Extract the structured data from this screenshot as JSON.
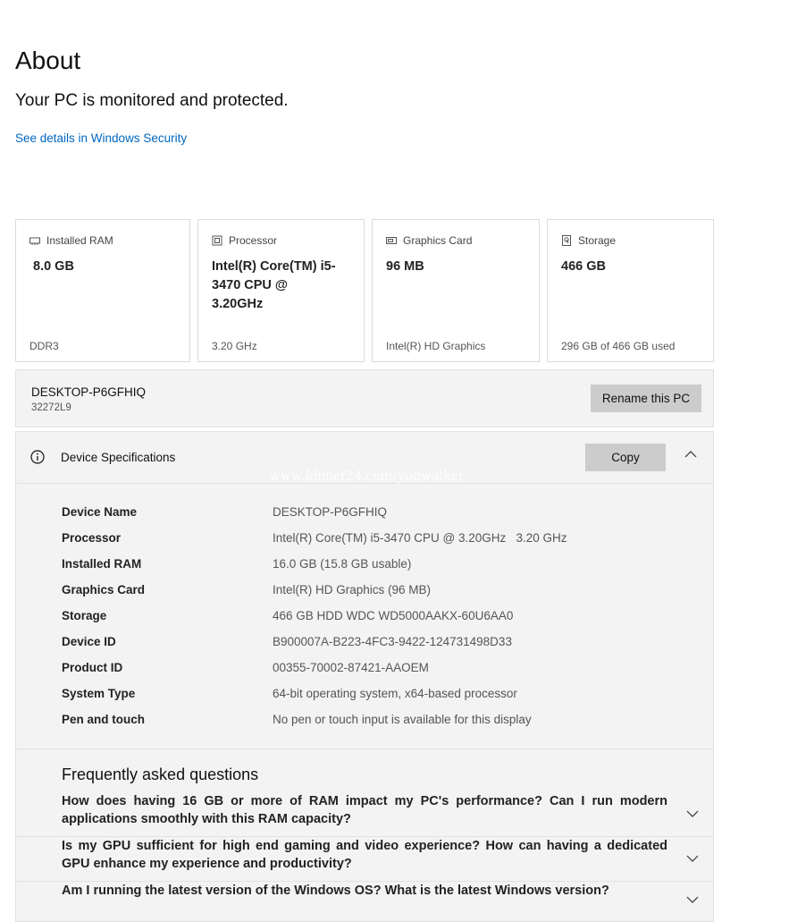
{
  "page": {
    "title": "About",
    "status": "Your PC is monitored and protected.",
    "security_link": "See details in Windows Security"
  },
  "cards": [
    {
      "label": "Installed RAM",
      "value": "8.0 GB",
      "sub": "DDR3",
      "icon": "ram-icon"
    },
    {
      "label": "Processor",
      "value": "Intel(R) Core(TM) i5-3470 CPU @ 3.20GHz",
      "sub": "3.20 GHz",
      "icon": "processor-icon"
    },
    {
      "label": "Graphics Card",
      "value": "96 MB",
      "sub": "Intel(R) HD Graphics",
      "icon": "graphics-card-icon"
    },
    {
      "label": "Storage",
      "value": "466 GB",
      "sub": "296 GB of 466 GB used",
      "icon": "storage-icon"
    }
  ],
  "pc": {
    "name": "DESKTOP-P6GFHIQ",
    "sub": "32272L9",
    "rename_label": "Rename this PC"
  },
  "specs": {
    "title": "Device Specifications",
    "copy_label": "Copy",
    "watermark": "www.khmer24.com/youwalker",
    "rows": [
      {
        "key": "Device Name",
        "value": "DESKTOP-P6GFHIQ"
      },
      {
        "key": "Processor",
        "value": "Intel(R) Core(TM) i5-3470 CPU @ 3.20GHz   3.20 GHz"
      },
      {
        "key": "Installed RAM",
        "value": "16.0 GB (15.8 GB usable)"
      },
      {
        "key": "Graphics Card",
        "value": "Intel(R) HD Graphics (96 MB)"
      },
      {
        "key": "Storage",
        "value": "466 GB HDD WDC WD5000AAKX-60U6AA0"
      },
      {
        "key": "Device ID",
        "value": "B900007A-B223-4FC3-9422-124731498D33"
      },
      {
        "key": "Product ID",
        "value": "00355-70002-87421-AAOEM"
      },
      {
        "key": "System Type",
        "value": "64-bit operating system, x64-based processor"
      },
      {
        "key": "Pen and touch",
        "value": "No pen or touch input is available for this display"
      }
    ]
  },
  "faq": {
    "title": "Frequently asked questions",
    "items": [
      {
        "q": "How does having 16 GB or more of RAM impact my PC's performance? Can I run modern applications smoothly with this RAM capacity?"
      },
      {
        "q": "Is my GPU sufficient for high end gaming and video experience? How can having a dedicated GPU enhance my experience and productivity?"
      },
      {
        "q": "Am I running the latest version of the Windows OS? What is the latest Windows version?"
      }
    ]
  },
  "colors": {
    "link": "#0067c0",
    "panel": "#f3f3f3",
    "button": "#cccccc"
  }
}
